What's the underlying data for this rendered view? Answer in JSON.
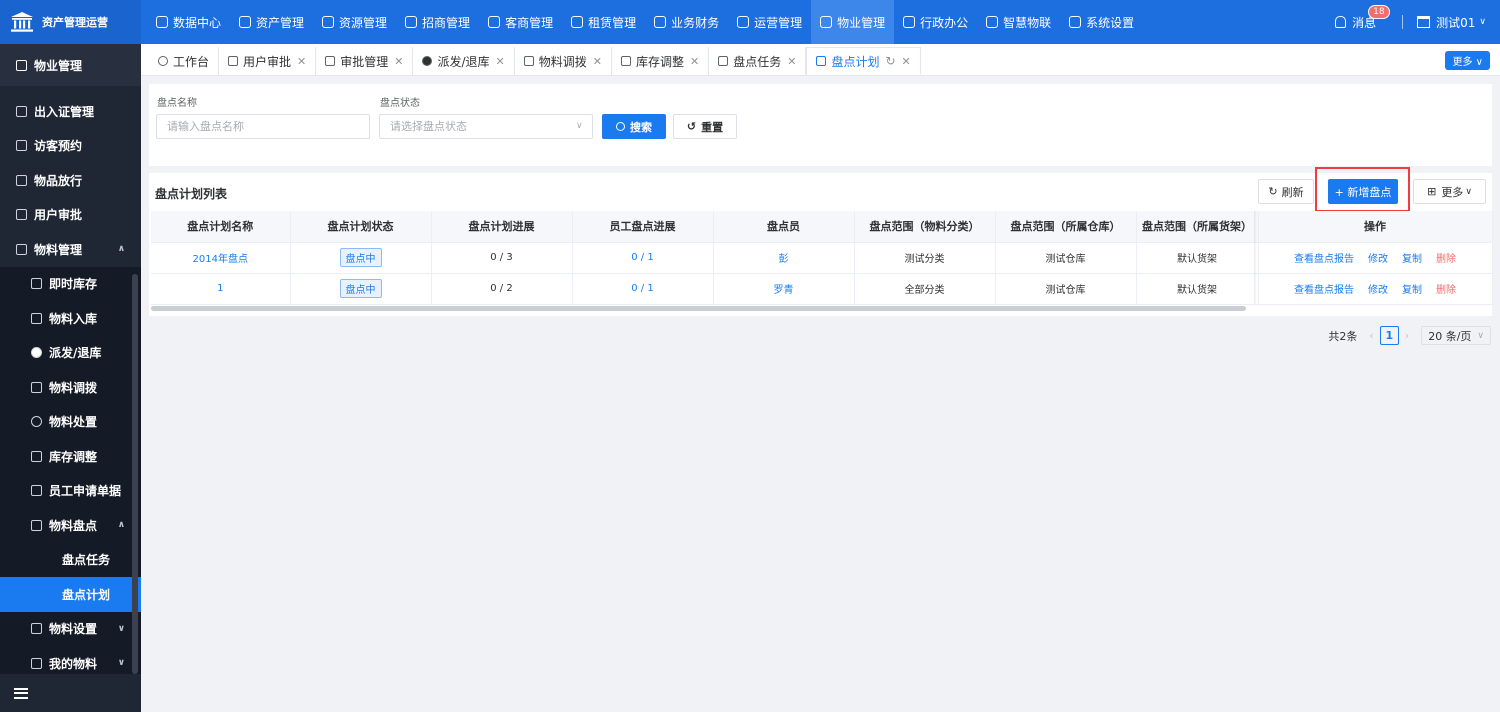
{
  "brand": {
    "title": "资产管理运营"
  },
  "topnav": {
    "items": [
      {
        "label": "数据中心",
        "active": false
      },
      {
        "label": "资产管理",
        "active": false
      },
      {
        "label": "资源管理",
        "active": false
      },
      {
        "label": "招商管理",
        "active": false
      },
      {
        "label": "客商管理",
        "active": false
      },
      {
        "label": "租赁管理",
        "active": false
      },
      {
        "label": "业务财务",
        "active": false
      },
      {
        "label": "运营管理",
        "active": false
      },
      {
        "label": "物业管理",
        "active": true
      },
      {
        "label": "行政办公",
        "active": false
      },
      {
        "label": "智慧物联",
        "active": false
      },
      {
        "label": "系统设置",
        "active": false
      }
    ],
    "message_label": "消息",
    "message_count": "18",
    "user_name": "测试01"
  },
  "sidebar": {
    "header": "物业管理",
    "items": [
      {
        "label": "出入证管理"
      },
      {
        "label": "访客预约"
      },
      {
        "label": "物品放行"
      },
      {
        "label": "用户审批"
      },
      {
        "label": "物料管理"
      },
      {
        "label": "即时库存"
      },
      {
        "label": "物料入库"
      },
      {
        "label": "派发/退库"
      },
      {
        "label": "物料调拨"
      },
      {
        "label": "物料处置"
      },
      {
        "label": "库存调整"
      },
      {
        "label": "员工申请单据"
      },
      {
        "label": "物料盘点"
      },
      {
        "label": "盘点任务"
      },
      {
        "label": "盘点计划"
      },
      {
        "label": "物料设置"
      },
      {
        "label": "我的物料"
      }
    ]
  },
  "tabs": {
    "items": [
      {
        "label": "工作台"
      },
      {
        "label": "用户审批"
      },
      {
        "label": "审批管理"
      },
      {
        "label": "派发/退库"
      },
      {
        "label": "物料调拨"
      },
      {
        "label": "库存调整"
      },
      {
        "label": "盘点任务"
      },
      {
        "label": "盘点计划"
      }
    ],
    "more_label": "更多"
  },
  "search": {
    "name_label": "盘点名称",
    "name_placeholder": "请输入盘点名称",
    "status_label": "盘点状态",
    "status_placeholder": "请选择盘点状态",
    "search_button": "搜索",
    "reset_button": "重置"
  },
  "list": {
    "title": "盘点计划列表",
    "refresh_button": "刷新",
    "add_button": "+ 新增盘点",
    "more_button": "更多",
    "columns": [
      "盘点计划名称",
      "盘点计划状态",
      "盘点计划进展",
      "员工盘点进展",
      "盘点员",
      "盘点范围（物料分类）",
      "盘点范围（所属仓库）",
      "盘点范围（所属货架）",
      "操作"
    ],
    "rows": [
      {
        "name": "2014年盘点",
        "status": "盘点中",
        "plan_progress": "0 / 3",
        "staff_progress": "0 / 1",
        "checker": "彭",
        "scope_category": "测试分类",
        "scope_warehouse": "测试仓库",
        "scope_shelf": "默认货架"
      },
      {
        "name": "1",
        "status": "盘点中",
        "plan_progress": "0 / 2",
        "staff_progress": "0 / 1",
        "checker": "罗青",
        "scope_category": "全部分类",
        "scope_warehouse": "测试仓库",
        "scope_shelf": "默认货架"
      }
    ],
    "actions": {
      "report": "查看盘点报告",
      "edit": "修改",
      "copy": "复制",
      "delete": "删除"
    }
  },
  "pagination": {
    "total": "共2条",
    "current_page": "1",
    "page_size": "20 条/页"
  }
}
